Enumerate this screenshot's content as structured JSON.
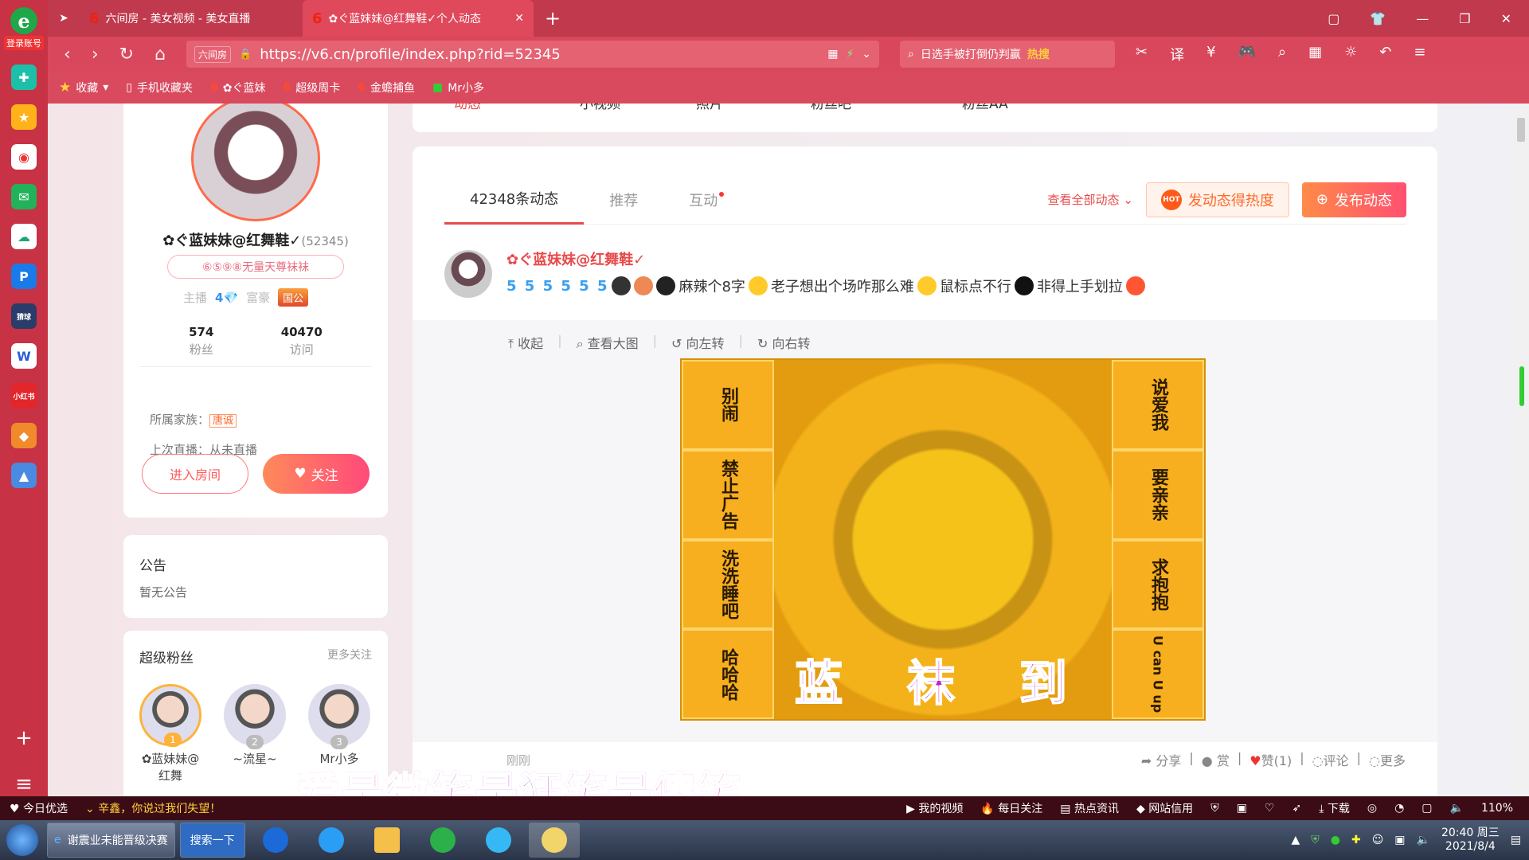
{
  "sidebar": {
    "login_label": "登录账号",
    "bottom_plus": "+",
    "bottom_menu": "≡"
  },
  "tabs": [
    {
      "label": "六间房 - 美女视频 - 美女直播",
      "active": false
    },
    {
      "label": "✿ぐ蓝妹妹@红舞鞋✓个人动态",
      "active": true
    }
  ],
  "address": {
    "site_tag": "六间房",
    "url": "https://v6.cn/profile/index.php?rid=52345"
  },
  "search": {
    "text": "日选手被打倒仍判赢",
    "hot": "热搜"
  },
  "bookmarks": [
    "收藏",
    "手机收藏夹",
    "✿ぐ蓝妹",
    "超级周卡",
    "金蟾捕鱼",
    "Mr小多"
  ],
  "profile": {
    "nickname": "✿ぐ蓝妹妹@红舞鞋✓",
    "rid": "(52345)",
    "badge": "⑥⑤⑨⑧无量天尊袜袜",
    "anchor_label": "主播",
    "anchor_level": "4",
    "rich_label": "富豪",
    "gov_badge": "国公",
    "fans_count": "574",
    "fans_label": "粉丝",
    "visits_count": "40470",
    "visits_label": "访问",
    "family_label": "所属家族：",
    "family_value": "唐诚",
    "last_live": "上次直播：从未直播",
    "enter_room": "进入房间",
    "follow": "关注"
  },
  "notice": {
    "title": "公告",
    "content": "暂无公告"
  },
  "super_fans": {
    "title": "超级粉丝",
    "more": "更多关注",
    "fans": [
      {
        "rank": "1",
        "name": "✿蓝妹妹@红舞"
      },
      {
        "rank": "2",
        "name": "~流星~"
      },
      {
        "rank": "3",
        "name": "Mr小多"
      }
    ]
  },
  "top_tabs": [
    "动态",
    "小视频",
    "照片",
    "粉丝吧",
    "粉丝AA"
  ],
  "feed": {
    "subtabs": [
      "42348条动态",
      "推荐",
      "互动"
    ],
    "view_all": "查看全部动态",
    "hot_button": "发动态得热度",
    "hot_badge": "HOT",
    "post_button": "发布动态",
    "post": {
      "author": "✿ぐ蓝妹妹@红舞鞋✓",
      "level_badges": "5 5 5 5 5 5",
      "segments": [
        "麻辣个8字",
        "老子想出个场咋那么难",
        "鼠标点不行",
        "非得上手划拉"
      ],
      "tools": [
        "收起",
        "查看大图",
        "向左转",
        "向右转"
      ],
      "image_left_col": [
        "别闹",
        "禁止广告",
        "洗洗睡吧",
        "哈哈哈"
      ],
      "image_right_col": [
        "说爱我",
        "要亲亲",
        "求抱抱",
        "U can U up"
      ],
      "image_caption": "蓝 袜 到",
      "time": "刚刚",
      "actions": [
        "分享",
        "赏",
        "赞(1)",
        "评论",
        "更多"
      ]
    }
  },
  "video_subtitle": "爱是微笑是狂笑是傻笑",
  "statusbar": {
    "left": [
      "今日优选",
      "辛鑫，你说过我们失望！"
    ],
    "right": [
      "我的视频",
      "每日关注",
      "热点资讯",
      "网站信用",
      "下载",
      "110%"
    ]
  },
  "taskbar": {
    "ie_window": "谢震业未能晋级决赛",
    "search_btn": "搜索一下",
    "clock_time": "20:40 周三",
    "clock_date": "2021/8/4"
  }
}
